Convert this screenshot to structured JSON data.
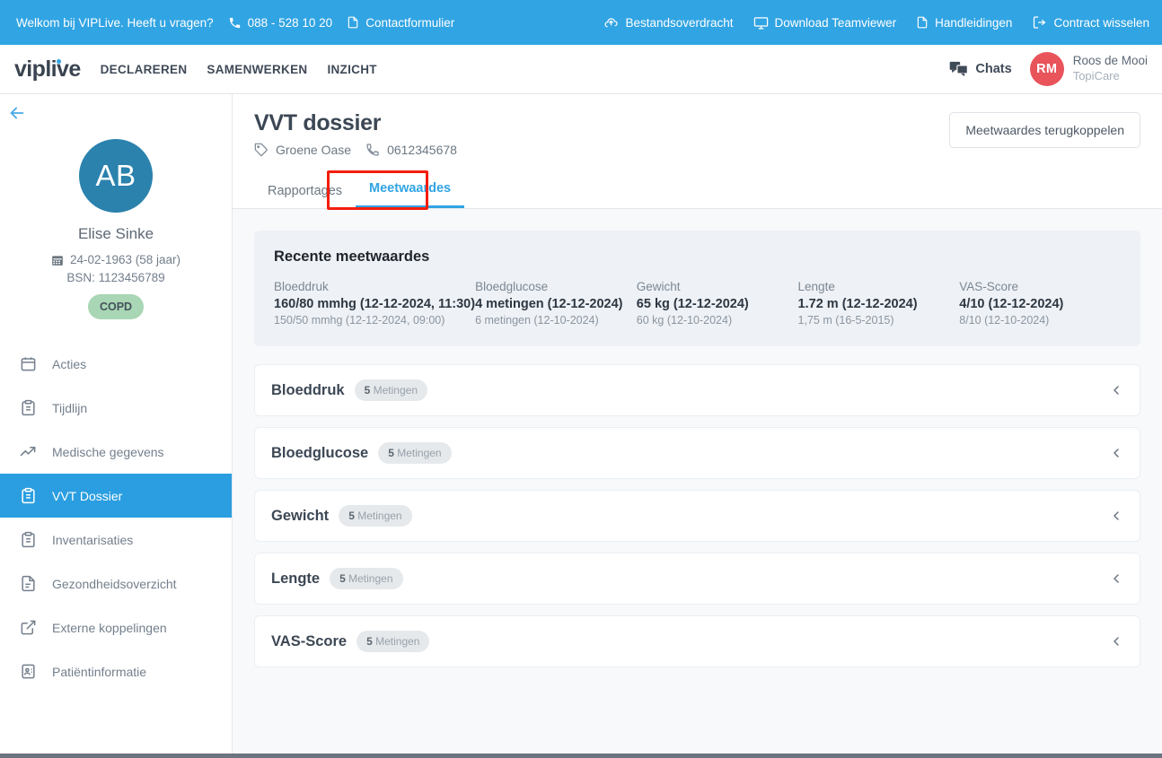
{
  "utilitybar": {
    "welcome_text": "Welkom bij VIPLive. Heeft u vragen?",
    "phone": "088 - 528 10 20",
    "contact_form": "Contactformulier",
    "right_items": [
      {
        "label": "Bestandsoverdracht",
        "icon": "cloud-upload-icon"
      },
      {
        "label": "Download Teamviewer",
        "icon": "monitor-icon"
      },
      {
        "label": "Handleidingen",
        "icon": "document-icon"
      },
      {
        "label": "Contract wisselen",
        "icon": "switch-icon"
      }
    ],
    "bg_color": "#31a4e3"
  },
  "mainnav": {
    "logo": "viplive",
    "links": [
      "DECLAREREN",
      "SAMENWERKEN",
      "INZICHT"
    ],
    "chats_label": "Chats",
    "user": {
      "initials": "RM",
      "name": "Roos de Mooi",
      "organization": "TopiCare",
      "avatar_color": "#e8545a"
    }
  },
  "sidebar": {
    "patient": {
      "initials": "AB",
      "avatar_color": "#2a82ad",
      "name": "Elise Sinke",
      "dob": "24-02-1963 (58 jaar)",
      "bsn": "BSN: 1123456789",
      "badge": "COPD",
      "badge_color": "#a9d6b4"
    },
    "items": [
      {
        "label": "Acties",
        "icon": "calendar-icon",
        "active": false
      },
      {
        "label": "Tijdlijn",
        "icon": "clipboard-list-icon",
        "active": false
      },
      {
        "label": "Medische gegevens",
        "icon": "trend-up-icon",
        "active": false
      },
      {
        "label": "VVT Dossier",
        "icon": "clipboard-check-icon",
        "active": true
      },
      {
        "label": "Inventarisaties",
        "icon": "clipboard-list-icon",
        "active": false
      },
      {
        "label": "Gezondheidsoverzicht",
        "icon": "document-lines-icon",
        "active": false
      },
      {
        "label": "Externe koppelingen",
        "icon": "external-link-icon",
        "active": false
      },
      {
        "label": "Patiëntinformatie",
        "icon": "id-card-icon",
        "active": false
      }
    ]
  },
  "page": {
    "title": "VVT dossier",
    "organization": "Groene Oase",
    "phone": "0612345678",
    "action_button": "Meetwaardes terugkoppelen",
    "tabs": [
      {
        "label": "Rapportages",
        "active": false
      },
      {
        "label": "Meetwaardes",
        "active": true
      }
    ],
    "highlight_color": "#f41e0c"
  },
  "recent": {
    "title": "Recente meetwaardes",
    "measurements": [
      {
        "label": "Bloeddruk",
        "primary": "160/80 mmhg (12-12-2024, 11:30)",
        "secondary": "150/50 mmhg (12-12-2024, 09:00)"
      },
      {
        "label": "Bloedglucose",
        "primary": "4 metingen (12-12-2024)",
        "secondary": "6 metingen (12-10-2024)"
      },
      {
        "label": "Gewicht",
        "primary": "65 kg (12-12-2024)",
        "secondary": "60 kg (12-10-2024)"
      },
      {
        "label": "Lengte",
        "primary": "1.72 m (12-12-2024)",
        "secondary": "1,75 m (16-5-2015)"
      },
      {
        "label": "VAS-Score",
        "primary": "4/10 (12-12-2024)",
        "secondary": "8/10 (12-10-2024)"
      }
    ]
  },
  "accordions": [
    {
      "title": "Bloeddruk",
      "count": "5",
      "count_label": "Metingen",
      "expanded": false
    },
    {
      "title": "Bloedglucose",
      "count": "5",
      "count_label": "Metingen",
      "expanded": false
    },
    {
      "title": "Gewicht",
      "count": "5",
      "count_label": "Metingen",
      "expanded": false
    },
    {
      "title": "Lengte",
      "count": "5",
      "count_label": "Metingen",
      "expanded": false
    },
    {
      "title": "VAS-Score",
      "count": "5",
      "count_label": "Metingen",
      "expanded": false
    }
  ]
}
